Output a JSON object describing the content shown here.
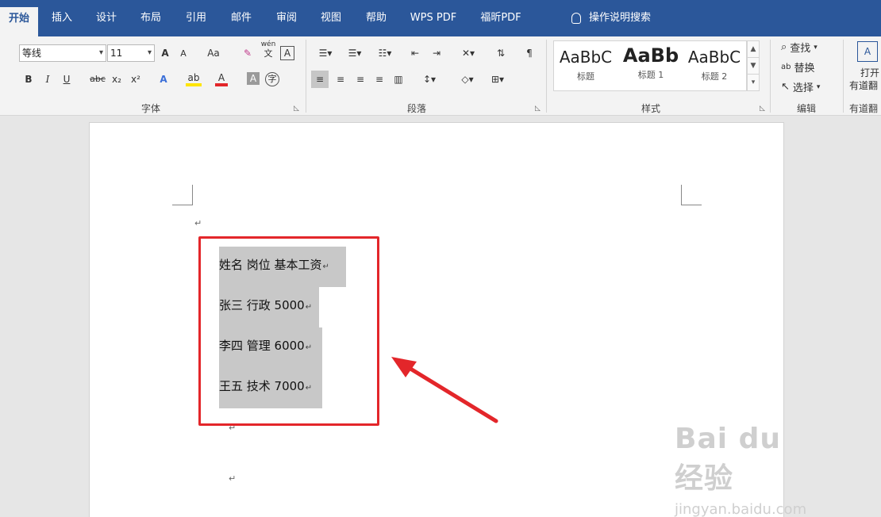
{
  "tabs": [
    {
      "label": "开始",
      "active": true
    },
    {
      "label": "插入"
    },
    {
      "label": "设计"
    },
    {
      "label": "布局"
    },
    {
      "label": "引用"
    },
    {
      "label": "邮件"
    },
    {
      "label": "审阅"
    },
    {
      "label": "视图"
    },
    {
      "label": "帮助"
    },
    {
      "label": "WPS PDF"
    },
    {
      "label": "福昕PDF"
    }
  ],
  "tell_me": "操作说明搜索",
  "font": {
    "name": "等线",
    "size": "11",
    "group_label": "字体",
    "grow": "A",
    "shrink": "A",
    "case": "Aa",
    "bold": "B",
    "italic": "I",
    "underline": "U",
    "strikethrough": "abc",
    "subscript": "x₂",
    "superscript": "x²",
    "text_effect": "A",
    "highlight": "ab",
    "font_color": "A",
    "char_shading": "A",
    "enclose": "字",
    "phonetic": "wén",
    "phonetic_char": "文",
    "char_border": "A"
  },
  "paragraph": {
    "group_label": "段落"
  },
  "styles": {
    "group_label": "样式",
    "items": [
      {
        "sample": "AaBbC",
        "name": "标题"
      },
      {
        "sample": "AaBb",
        "name": "标题 1"
      },
      {
        "sample": "AaBbC",
        "name": "标题 2"
      }
    ]
  },
  "editing": {
    "group_label": "编辑",
    "find": "查找",
    "replace": "替换",
    "select": "选择"
  },
  "youdao": {
    "label_line1": "打开",
    "label_line2": "有道翻",
    "group_label": "有道翻"
  },
  "document": {
    "lines": [
      "姓名 岗位 基本工资",
      "张三 行政 5000",
      "李四 管理 6000",
      "王五 技术 7000"
    ],
    "para_mark": "↵"
  },
  "watermark": {
    "main": "Bai du 经验",
    "sub": "jingyan.baidu.com"
  },
  "colors": {
    "tab_bar": "#2b579a",
    "annotation_red": "#e3262a",
    "selection": "#c8c8c8"
  }
}
